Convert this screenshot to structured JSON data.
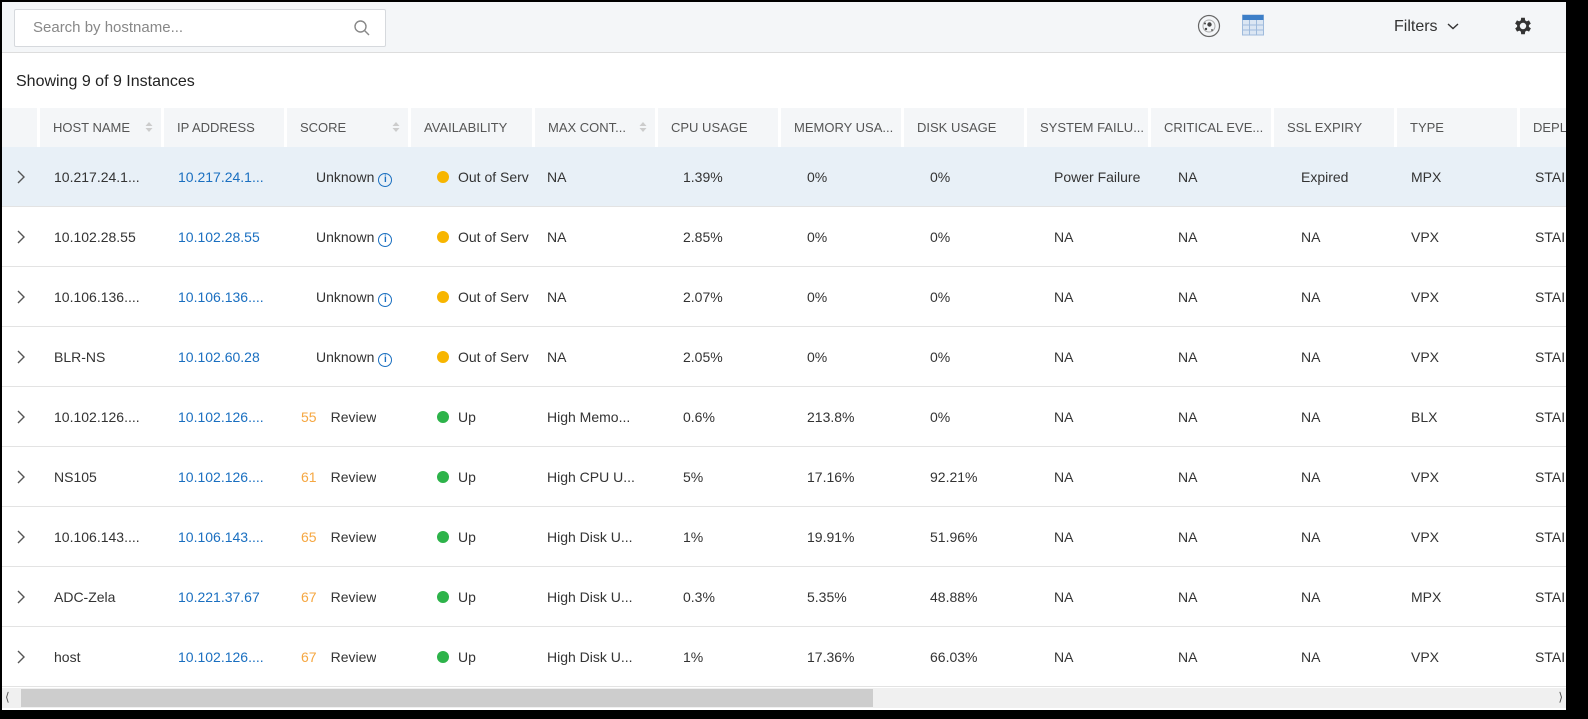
{
  "toolbar": {
    "search_placeholder": "Search by hostname...",
    "filters_label": "Filters",
    "icons": [
      "search-icon",
      "cluster-view-icon",
      "table-view-icon",
      "chevron-down-icon",
      "gear-icon"
    ],
    "accent": "#1a6fc0"
  },
  "summary": "Showing 9 of 9 Instances",
  "columns": [
    "HOST NAME",
    "IP ADDRESS",
    "SCORE",
    "AVAILABILITY",
    "MAX CONT...",
    "CPU USAGE",
    "MEMORY USA...",
    "DISK USAGE",
    "SYSTEM FAILU...",
    "CRITICAL EVE...",
    "SSL EXPIRY",
    "TYPE",
    "DEPL"
  ],
  "status_colors": {
    "Out of Serv": "#f7b500",
    "Up": "#2db34a"
  },
  "rows": [
    {
      "host": "10.217.24.1...",
      "ip": "10.217.24.1...",
      "score": "",
      "score_label": "Unknown",
      "availability": "Out of Serv",
      "max": "NA",
      "cpu": "1.39%",
      "mem": "0%",
      "disk": "0%",
      "sys": "Power Failure",
      "crit": "NA",
      "ssl": "Expired",
      "type": "MPX",
      "depl": "STAI"
    },
    {
      "host": "10.102.28.55",
      "ip": "10.102.28.55",
      "score": "",
      "score_label": "Unknown",
      "availability": "Out of Serv",
      "max": "NA",
      "cpu": "2.85%",
      "mem": "0%",
      "disk": "0%",
      "sys": "NA",
      "crit": "NA",
      "ssl": "NA",
      "type": "VPX",
      "depl": "STAI"
    },
    {
      "host": "10.106.136....",
      "ip": "10.106.136....",
      "score": "",
      "score_label": "Unknown",
      "availability": "Out of Serv",
      "max": "NA",
      "cpu": "2.07%",
      "mem": "0%",
      "disk": "0%",
      "sys": "NA",
      "crit": "NA",
      "ssl": "NA",
      "type": "VPX",
      "depl": "STAI"
    },
    {
      "host": "BLR-NS",
      "ip": "10.102.60.28",
      "score": "",
      "score_label": "Unknown",
      "availability": "Out of Serv",
      "max": "NA",
      "cpu": "2.05%",
      "mem": "0%",
      "disk": "0%",
      "sys": "NA",
      "crit": "NA",
      "ssl": "NA",
      "type": "VPX",
      "depl": "STAI"
    },
    {
      "host": "10.102.126....",
      "ip": "10.102.126....",
      "score": "55",
      "score_label": "Review",
      "availability": "Up",
      "max": "High Memo...",
      "cpu": "0.6%",
      "mem": "213.8%",
      "disk": "0%",
      "sys": "NA",
      "crit": "NA",
      "ssl": "NA",
      "type": "BLX",
      "depl": "STAI"
    },
    {
      "host": "NS105",
      "ip": "10.102.126....",
      "score": "61",
      "score_label": "Review",
      "availability": "Up",
      "max": "High CPU U...",
      "cpu": "5%",
      "mem": "17.16%",
      "disk": "92.21%",
      "sys": "NA",
      "crit": "NA",
      "ssl": "NA",
      "type": "VPX",
      "depl": "STAI"
    },
    {
      "host": "10.106.143....",
      "ip": "10.106.143....",
      "score": "65",
      "score_label": "Review",
      "availability": "Up",
      "max": "High Disk U...",
      "cpu": "1%",
      "mem": "19.91%",
      "disk": "51.96%",
      "sys": "NA",
      "crit": "NA",
      "ssl": "NA",
      "type": "VPX",
      "depl": "STAI"
    },
    {
      "host": "ADC-Zela",
      "ip": "10.221.37.67",
      "score": "67",
      "score_label": "Review",
      "availability": "Up",
      "max": "High Disk U...",
      "cpu": "0.3%",
      "mem": "5.35%",
      "disk": "48.88%",
      "sys": "NA",
      "crit": "NA",
      "ssl": "NA",
      "type": "MPX",
      "depl": "STAI"
    },
    {
      "host": "host",
      "ip": "10.102.126....",
      "score": "67",
      "score_label": "Review",
      "availability": "Up",
      "max": "High Disk U...",
      "cpu": "1%",
      "mem": "17.36%",
      "disk": "66.03%",
      "sys": "NA",
      "crit": "NA",
      "ssl": "NA",
      "type": "VPX",
      "depl": "STAI"
    }
  ]
}
